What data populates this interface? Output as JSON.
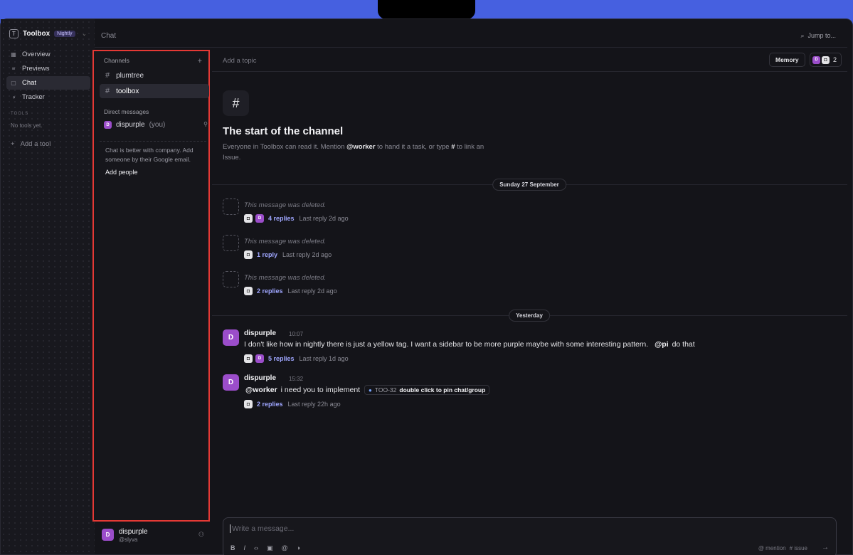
{
  "app": {
    "name": "Toolbox",
    "badge": "Nightly",
    "brand_letter": "T"
  },
  "nav": {
    "items": [
      {
        "label": "Overview",
        "icon": "grid-icon"
      },
      {
        "label": "Previews",
        "icon": "list-icon"
      },
      {
        "label": "Chat",
        "icon": "chat-bubble-icon",
        "active": true
      },
      {
        "label": "Tracker",
        "icon": "half-circle-icon"
      }
    ],
    "tools_label": "TOOLS",
    "no_tools": "No tools yet.",
    "add_tool": "Add a tool"
  },
  "topbar": {
    "title": "Chat",
    "jump": "Jump to..."
  },
  "channels": {
    "label": "Channels",
    "items": [
      {
        "name": "plumtree"
      },
      {
        "name": "toolbox",
        "active": true
      }
    ],
    "dm_label": "Direct messages",
    "dm": {
      "initial": "D",
      "name": "dispurple",
      "suffix": "(you)"
    },
    "invite_text": "Chat is better with company. Add someone by their Google email.",
    "invite_link": "Add people"
  },
  "user": {
    "initial": "D",
    "name": "dispurple",
    "handle": "@slyva"
  },
  "header": {
    "topic_placeholder": "Add a topic",
    "memory": "Memory",
    "member_initial": "D",
    "member_count": "2"
  },
  "intro": {
    "title": "The start of the channel",
    "desc_1": "Everyone in Toolbox can read it. Mention ",
    "desc_mention": "@worker",
    "desc_2": " to hand it a task, or type ",
    "desc_hash": "#",
    "desc_3": " to link an Issue."
  },
  "dates": {
    "first": "Sunday 27 September",
    "second": "Yesterday"
  },
  "deleted_messages": [
    {
      "text": "This message was deleted.",
      "avatars": [
        "bot",
        "D"
      ],
      "replies": "4 replies",
      "last": "Last reply 2d ago"
    },
    {
      "text": "This message was deleted.",
      "avatars": [
        "bot"
      ],
      "replies": "1 reply",
      "last": "Last reply 2d ago"
    },
    {
      "text": "This message was deleted.",
      "avatars": [
        "bot"
      ],
      "replies": "2 replies",
      "last": "Last reply 2d ago"
    }
  ],
  "messages": [
    {
      "initial": "D",
      "author": "dispurple",
      "time": "10:07",
      "text": "I don't like how in nightly there is just a yellow tag. I want a sidebar to be more purple maybe with some interesting pattern.",
      "mention": "@pi",
      "text_after": "do that",
      "replies": "5 replies",
      "last": "Last reply 1d ago"
    },
    {
      "initial": "D",
      "author": "dispurple",
      "time": "15:32",
      "mention": "@worker",
      "text": "i need you to implement",
      "issue_id": "TOO-32",
      "issue_title": "double click to pin chat/group",
      "replies": "2 replies",
      "last": "Last reply 22h ago"
    }
  ],
  "composer": {
    "placeholder": "Write a message...",
    "hint_mention": "@ mention",
    "hint_issue": "# issue"
  }
}
